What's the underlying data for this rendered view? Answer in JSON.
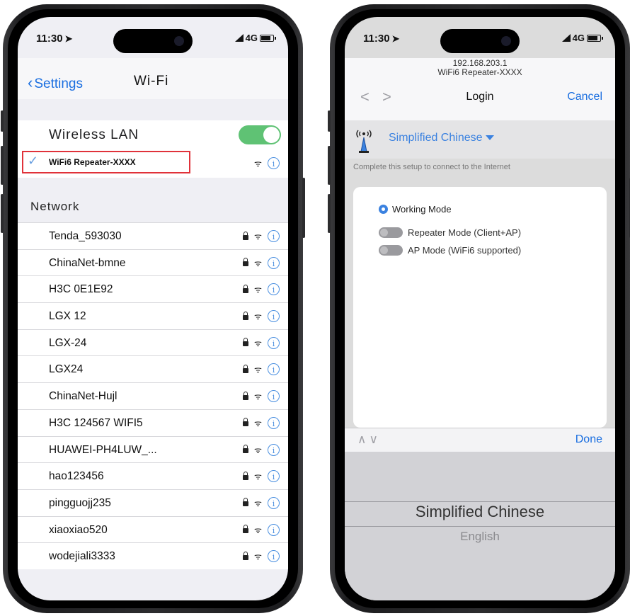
{
  "left_phone": {
    "status": {
      "time": "11:30",
      "network": "4G"
    },
    "nav": {
      "back_label": "Settings",
      "title": "Wi-Fi"
    },
    "wireless_lan": {
      "label": "Wireless LAN",
      "enabled": true
    },
    "connected_network": "WiFi6 Repeater-XXXX",
    "section_header": "Network",
    "networks": [
      "Tenda_593030",
      "ChinaNet-bmne",
      "H3C 0E1E92",
      "LGX 12",
      "LGX-24",
      "LGX24",
      "ChinaNet-Hujl",
      "H3C 124567 WIFI5",
      "HUAWEI-PH4LUW_...",
      "hao123456",
      "pingguojj235",
      "xiaoxiao520",
      "wodejiali3333"
    ],
    "info_glyph": "i",
    "colors": {
      "accent": "#1b6fe0",
      "toggle_on": "#5fc274",
      "highlight": "#e0323a"
    }
  },
  "right_phone": {
    "status": {
      "time": "11:30",
      "network": "4G"
    },
    "browser": {
      "url": "192.168.203.1",
      "page_title": "WiFi6 Repeater-XXXX",
      "nav_arrows": "< >",
      "login_label": "Login",
      "cancel_label": "Cancel"
    },
    "language": {
      "selected": "Simplified Chinese"
    },
    "setup_note": "Complete this setup to connect to the Internet",
    "working_mode": {
      "title": "Working Mode",
      "options": [
        "Repeater Mode (Client+AP)",
        "AP Mode (WiFi6 supported)"
      ]
    },
    "picker": {
      "arrows": "∧∨",
      "done_label": "Done",
      "options": [
        "Simplified Chinese",
        "English"
      ]
    }
  }
}
